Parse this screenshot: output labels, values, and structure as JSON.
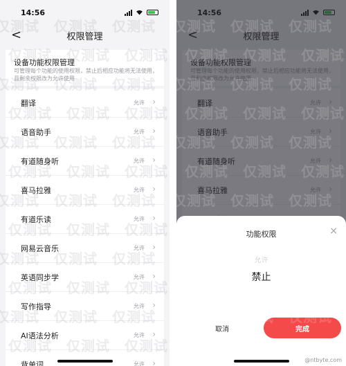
{
  "status_bar": {
    "time": "14:56"
  },
  "nav": {
    "title": "权限管理",
    "back_glyph": "<"
  },
  "section": {
    "title": "设备功能权限管理",
    "description": "可管理每个功能的使用权限，禁止后相应功能将无法使用，且剩余权限改为允许使用"
  },
  "apps": [
    {
      "label": "翻译",
      "status": "允许"
    },
    {
      "label": "语音助手",
      "status": "允许"
    },
    {
      "label": "有道随身听",
      "status": "允许"
    },
    {
      "label": "喜马拉雅",
      "status": "允许"
    },
    {
      "label": "有道乐读",
      "status": "允许"
    },
    {
      "label": "网易云音乐",
      "status": "允许"
    },
    {
      "label": "英语同步学",
      "status": "允许"
    },
    {
      "label": "写作指导",
      "status": "允许"
    },
    {
      "label": "AI语法分析",
      "status": "允许"
    },
    {
      "label": "背单词",
      "status": "允许"
    }
  ],
  "sheet": {
    "title": "功能权限",
    "ghost_option": "允许",
    "selected_option": "禁止",
    "cancel_label": "取消",
    "confirm_label": "完成",
    "close_glyph": "×"
  },
  "watermark": {
    "text": "仅测试",
    "credit": "@ntbyte.com"
  },
  "colors": {
    "accent_red": "#f44a4a",
    "battery_green": "#3ac250",
    "overlay": "#3c3c46",
    "background": "#f4f4f6"
  },
  "icons": [
    "back-chevron-icon",
    "signal-icon",
    "wifi-icon",
    "battery-icon",
    "chevron-right-icon",
    "close-icon"
  ]
}
